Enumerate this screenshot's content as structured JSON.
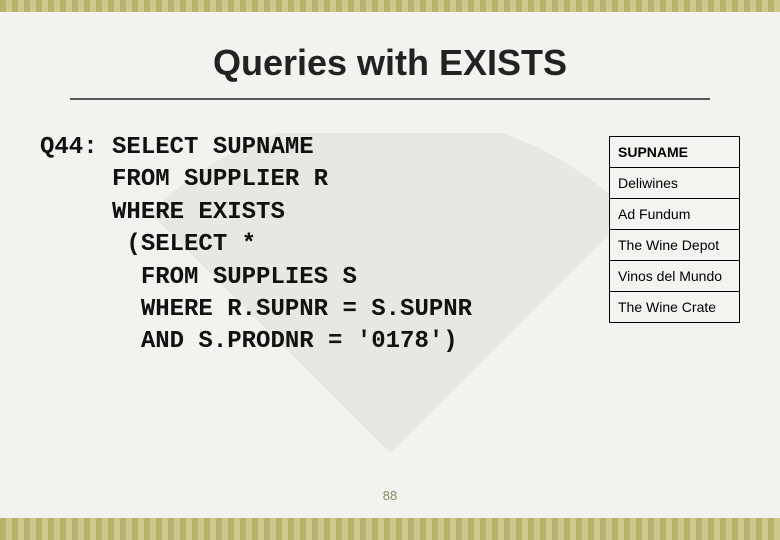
{
  "title": "Queries with EXISTS",
  "code": {
    "l1": "Q44: SELECT SUPNAME",
    "l2": "     FROM SUPPLIER R",
    "l3": "     WHERE EXISTS",
    "l4": "      (SELECT *",
    "l5": "       FROM SUPPLIES S",
    "l6": "       WHERE R.SUPNR = S.SUPNR",
    "l7": "       AND S.PRODNR = '0178')"
  },
  "table": {
    "header": "SUPNAME",
    "rows": [
      "Deliwines",
      "Ad Fundum",
      "The Wine Depot",
      "Vinos del Mundo",
      "The Wine Crate"
    ]
  },
  "page_number": "88"
}
